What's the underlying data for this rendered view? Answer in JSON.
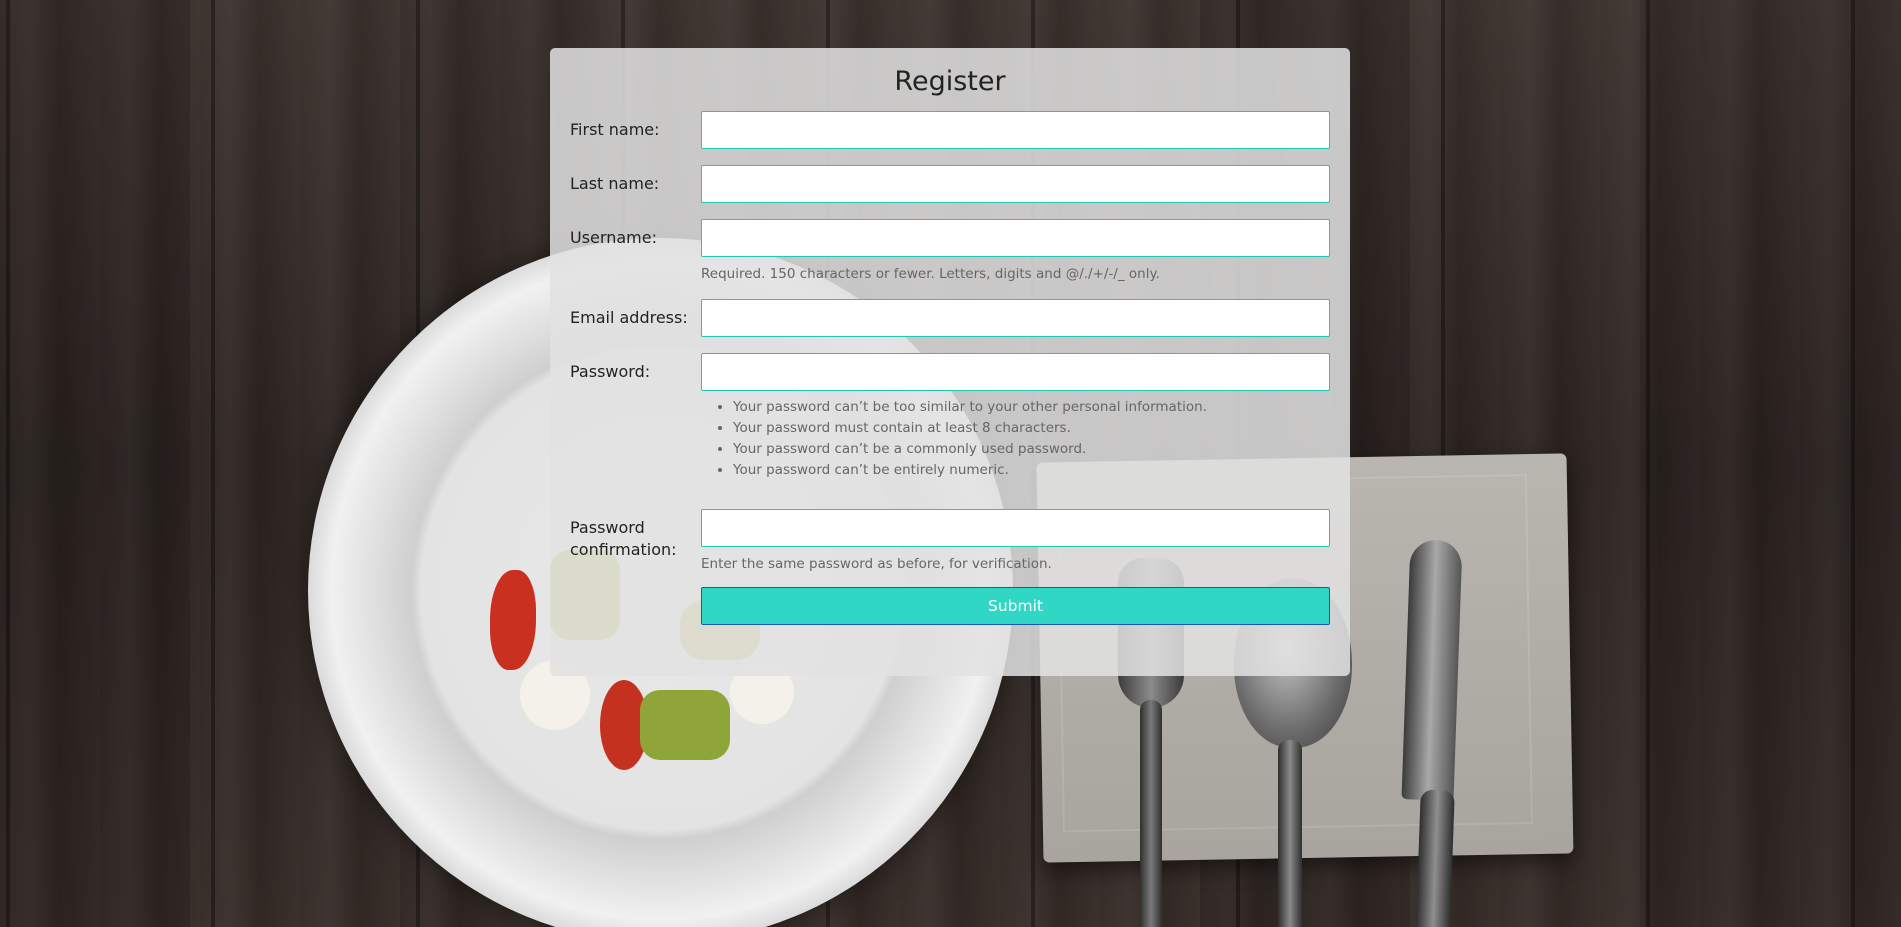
{
  "form": {
    "title": "Register",
    "fields": {
      "first_name": {
        "label": "First name:",
        "value": ""
      },
      "last_name": {
        "label": "Last name:",
        "value": ""
      },
      "username": {
        "label": "Username:",
        "value": "",
        "help": "Required. 150 characters or fewer. Letters, digits and @/./+/-/_ only."
      },
      "email": {
        "label": "Email address:",
        "value": ""
      },
      "password": {
        "label": "Password:",
        "value": "",
        "help_items": [
          "Your password can’t be too similar to your other personal information.",
          "Your password must contain at least 8 characters.",
          "Your password can’t be a commonly used password.",
          "Your password can’t be entirely numeric."
        ]
      },
      "password_confirmation": {
        "label_line1": "Password",
        "label_line2": "confirmation:",
        "value": "",
        "help": "Enter the same password as before, for verification."
      }
    },
    "submit_label": "Submit"
  },
  "colors": {
    "accent": "#2fd7c4",
    "input_border": "#1fc9b3",
    "submit_border": "#1a58b5",
    "card_bg": "#e2e2e2"
  },
  "background": {
    "description_icon": "dining-table-photo"
  }
}
